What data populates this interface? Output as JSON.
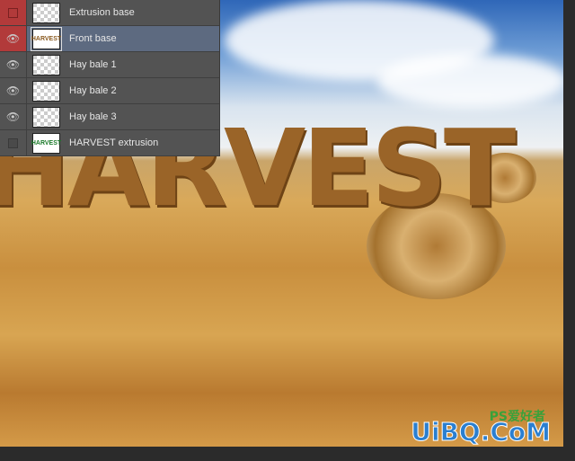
{
  "canvas": {
    "text": "HARVEST"
  },
  "layers": [
    {
      "name": "Extrusion base",
      "visible": false,
      "thumb": ""
    },
    {
      "name": "Front base",
      "visible": true,
      "selected": true,
      "thumb": "HARVEST"
    },
    {
      "name": "Hay bale 1",
      "visible": true,
      "thumb": ""
    },
    {
      "name": "Hay bale 2",
      "visible": true,
      "thumb": ""
    },
    {
      "name": "Hay bale 3",
      "visible": true,
      "thumb": ""
    },
    {
      "name": "HARVEST extrusion",
      "visible": false,
      "thumb": "HARVEST"
    }
  ],
  "watermark": {
    "main": "UiBQ.CoM",
    "sub": "PS爱好者"
  },
  "colors": {
    "selected_row": "#5d6a80",
    "panel": "#535353",
    "visibility_red": "#b23a3a"
  }
}
